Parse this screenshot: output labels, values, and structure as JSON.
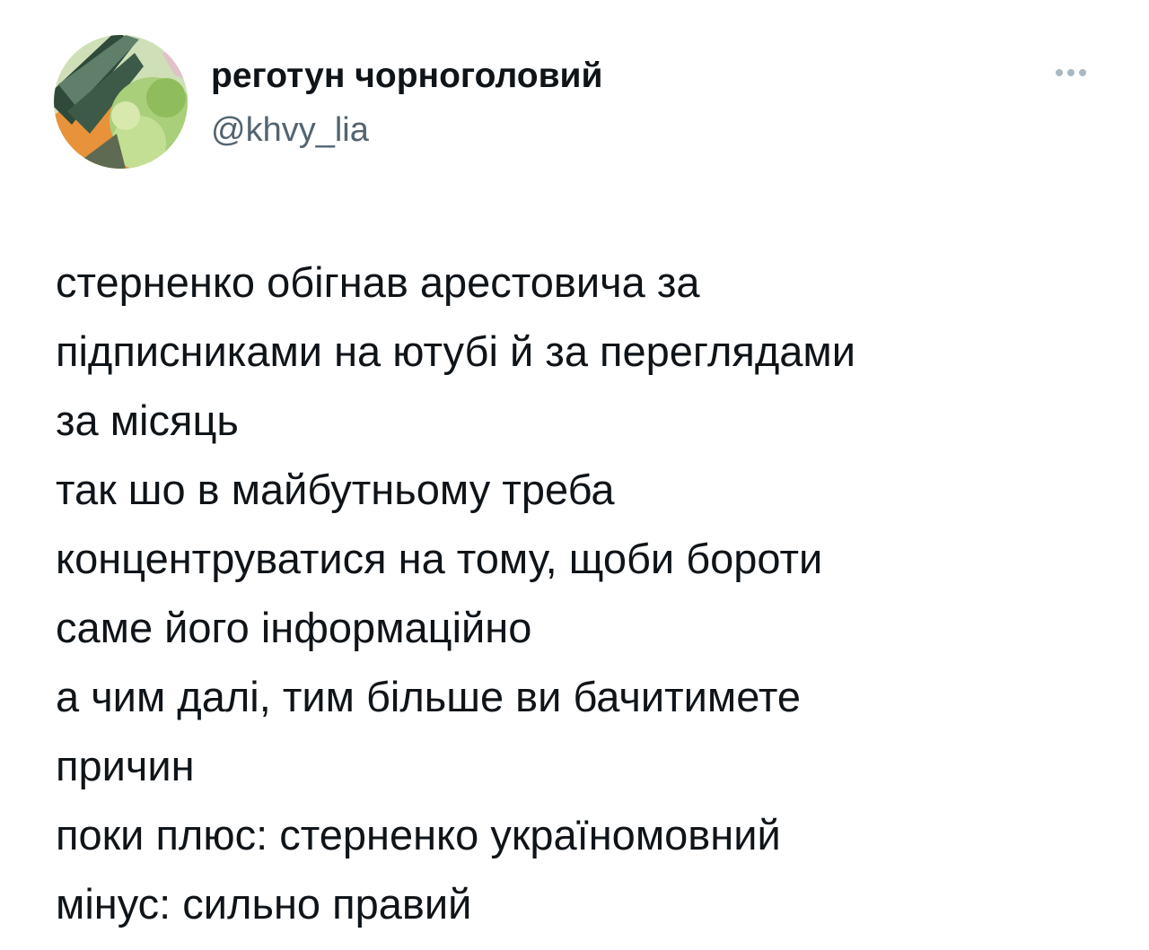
{
  "tweet": {
    "display_name": "реготун чорноголовий",
    "handle": "@khvy_lia",
    "avatar_icon": "profile-photo-avatar",
    "more_icon": "ellipsis-icon",
    "text_lines": [
      "стерненко обігнав арестовича за",
      "підписниками на ютубі й за переглядами",
      "за місяць",
      "так шо в майбутньому треба",
      "концентруватися на тому, щоби бороти",
      "саме його інформаційно",
      "а чим далі, тим більше ви бачитимете",
      "причин",
      "поки плюс: стерненко україномовний",
      "мінус: сильно правий"
    ]
  },
  "colors": {
    "text": "#0f1419",
    "secondary_text": "#536471",
    "more_icon": "#aab8c2",
    "background": "#ffffff"
  }
}
